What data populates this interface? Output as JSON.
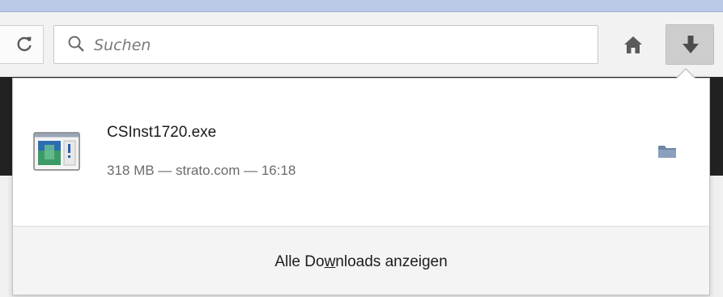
{
  "toolbar": {
    "search_placeholder": "Suchen",
    "reload_icon": "reload-icon",
    "home_icon": "home-icon",
    "download_icon": "download-arrow-icon"
  },
  "download_panel": {
    "item": {
      "file_name": "CSInst1720.exe",
      "details": "318 MB — strato.com — 16:18",
      "file_icon": "executable-file-icon",
      "folder_icon": "open-folder-icon"
    },
    "footer": {
      "label_before": "Alle Do",
      "label_accesskey": "w",
      "label_after": "nloads anzeigen"
    }
  },
  "colors": {
    "toolbar_bg": "#f2f2f2",
    "window_border": "#b9c9e6",
    "dark_background": "#222222",
    "panel_bg": "#ffffff",
    "footer_bg": "#f4f4f4"
  }
}
